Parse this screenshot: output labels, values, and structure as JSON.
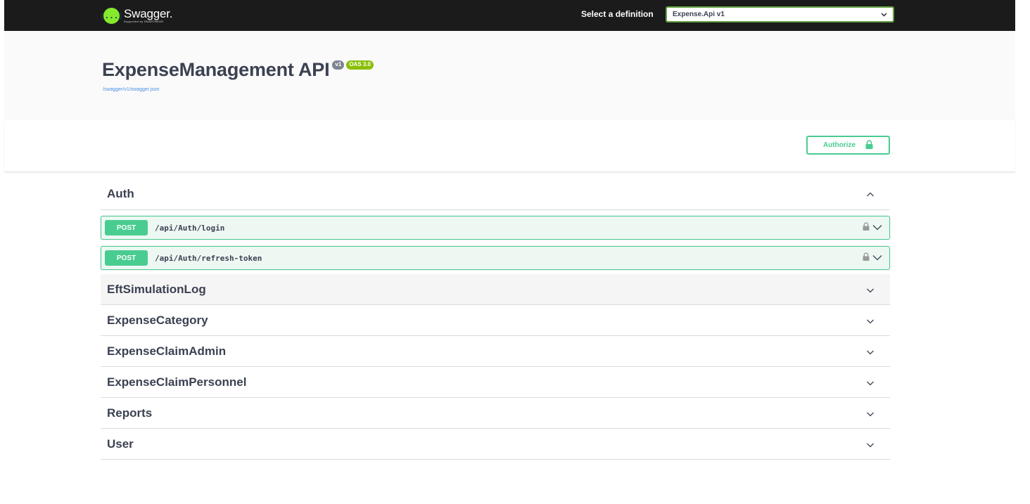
{
  "topbar": {
    "logo_icon": "{...}",
    "logo_title": "Swagger.",
    "logo_subtitle": "Supported by SMARTBEAR",
    "definition_label": "Select a definition",
    "definition_value": "Expense.Api v1"
  },
  "info": {
    "title": "ExpenseManagement API",
    "version_badge": "v1",
    "oas_badge": "OAS 3.0",
    "spec_link": "/swagger/v1/swagger.json"
  },
  "authorize": {
    "label": "Authorize",
    "icon": "lock-icon"
  },
  "colors": {
    "topbar": "#1b1b1b",
    "post": "#49cc90",
    "post_bg": "#edf8f3",
    "oas_badge": "#89bf04",
    "version_badge": "#7d8492",
    "link": "#4990e2"
  },
  "tags": [
    {
      "name": "Auth",
      "expanded": true,
      "operations": [
        {
          "method": "POST",
          "path": "/api/Auth/login"
        },
        {
          "method": "POST",
          "path": "/api/Auth/refresh-token"
        }
      ]
    },
    {
      "name": "EftSimulationLog",
      "expanded": false
    },
    {
      "name": "ExpenseCategory",
      "expanded": false
    },
    {
      "name": "ExpenseClaimAdmin",
      "expanded": false
    },
    {
      "name": "ExpenseClaimPersonnel",
      "expanded": false
    },
    {
      "name": "Reports",
      "expanded": false
    },
    {
      "name": "User",
      "expanded": false
    }
  ]
}
